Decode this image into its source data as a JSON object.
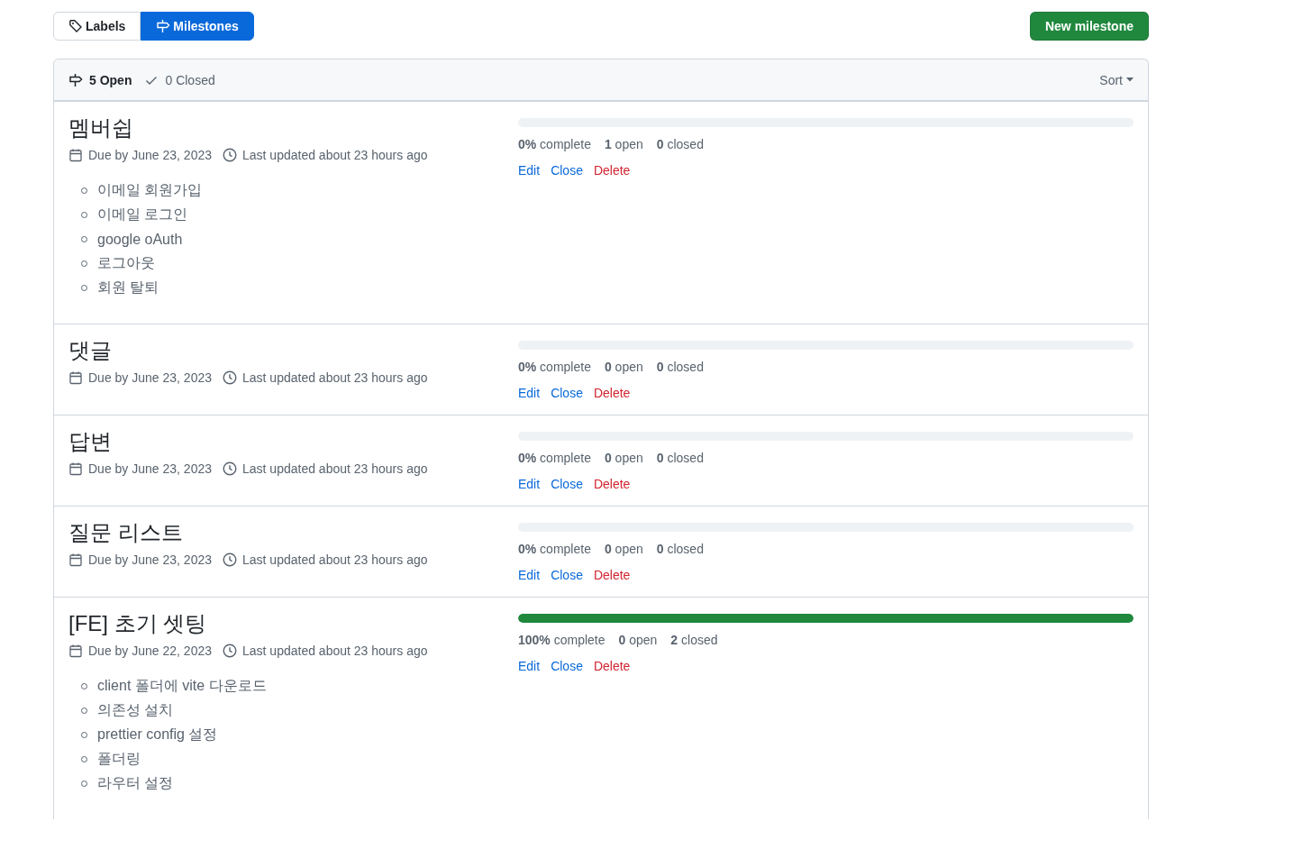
{
  "tabs": [
    {
      "label": "Labels",
      "kind": "label",
      "selected": false
    },
    {
      "label": "Milestones",
      "kind": "milestone",
      "selected": true
    }
  ],
  "new_button": "New milestone",
  "states": [
    {
      "label": "5 Open",
      "kind": "open",
      "selected": true
    },
    {
      "label": "0 Closed",
      "kind": "closed",
      "selected": false
    }
  ],
  "sort": "Sort",
  "milestones": [
    {
      "title": "멤버쉽",
      "due": "Due by June 23, 2023",
      "updated": "Last updated about 23 hours ago",
      "level": 0,
      "complete": "**0%** complete",
      "open": "**1** open",
      "closed": "**0** closed",
      "actions": [
        {
          "label": "Edit",
          "kind": "link"
        },
        {
          "label": "Close",
          "kind": "link"
        },
        {
          "label": "Delete",
          "kind": "danger"
        }
      ],
      "description": [
        "이메일 회원가입",
        "이메일 로그인",
        "google oAuth",
        "로그아웃",
        "회원 탈퇴"
      ]
    },
    {
      "title": "댓글",
      "due": "Due by June 23, 2023",
      "updated": "Last updated about 23 hours ago",
      "level": 0,
      "complete": "**0%** complete",
      "open": "**0** open",
      "closed": "**0** closed",
      "actions": [
        {
          "label": "Edit",
          "kind": "link"
        },
        {
          "label": "Close",
          "kind": "link"
        },
        {
          "label": "Delete",
          "kind": "danger"
        }
      ]
    },
    {
      "title": "답변",
      "due": "Due by June 23, 2023",
      "updated": "Last updated about 23 hours ago",
      "level": 0,
      "complete": "**0%** complete",
      "open": "**0** open",
      "closed": "**0** closed",
      "actions": [
        {
          "label": "Edit",
          "kind": "link"
        },
        {
          "label": "Close",
          "kind": "link"
        },
        {
          "label": "Delete",
          "kind": "danger"
        }
      ]
    },
    {
      "title": "질문 리스트",
      "due": "Due by June 23, 2023",
      "updated": "Last updated about 23 hours ago",
      "level": 0,
      "complete": "**0%** complete",
      "open": "**0** open",
      "closed": "**0** closed",
      "actions": [
        {
          "label": "Edit",
          "kind": "link"
        },
        {
          "label": "Close",
          "kind": "link"
        },
        {
          "label": "Delete",
          "kind": "danger"
        }
      ]
    },
    {
      "title": "[FE] 초기 셋팅",
      "due": "Due by June 22, 2023",
      "updated": "Last updated about 23 hours ago",
      "level": 1,
      "complete": "**100%** complete",
      "open": "**0** open",
      "closed": "**2** closed",
      "actions": [
        {
          "label": "Edit",
          "kind": "link"
        },
        {
          "label": "Close",
          "kind": "link"
        },
        {
          "label": "Delete",
          "kind": "danger"
        }
      ],
      "description": [
        "client 폴더에 vite 다운로드",
        "의존성 설치",
        "prettier config 설정",
        "폴더링",
        "라우터 설정"
      ]
    }
  ]
}
